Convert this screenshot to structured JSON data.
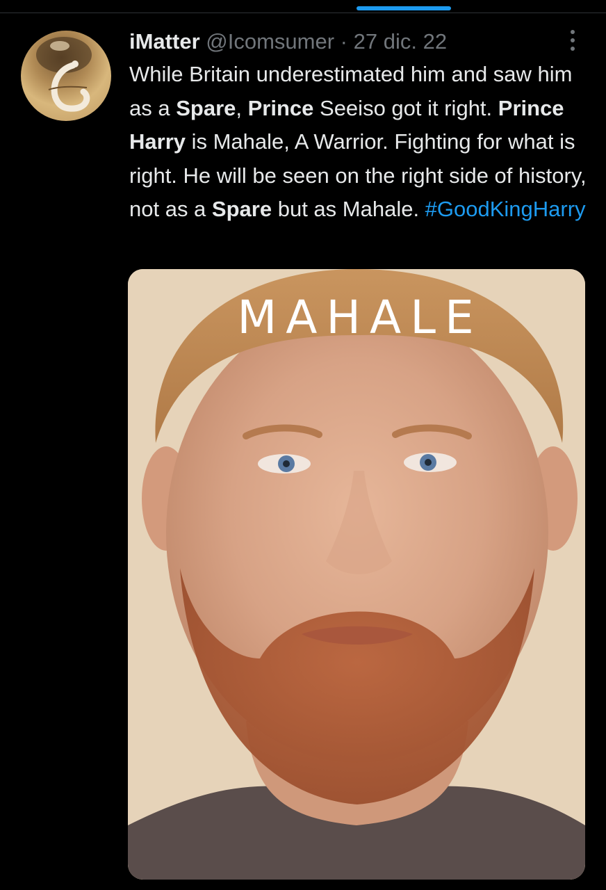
{
  "tweet": {
    "author_name": "iMatter",
    "handle": "@Icomsumer",
    "separator": "·",
    "date": "27 dic. 22",
    "text_parts": [
      {
        "t": "While Britain underestimated him and saw him as a ",
        "style": "plain"
      },
      {
        "t": "Spare",
        "style": "bold"
      },
      {
        "t": ", ",
        "style": "plain"
      },
      {
        "t": "Prince",
        "style": "bold"
      },
      {
        "t": " Seeiso got it right. ",
        "style": "plain"
      },
      {
        "t": "Prince Harry",
        "style": "bold"
      },
      {
        "t": " is Mahale, A Warrior. Fighting for what is right. He will be seen on the right side of history, not as a ",
        "style": "plain"
      },
      {
        "t": "Spare",
        "style": "bold"
      },
      {
        "t": " but as Mahale. ",
        "style": "plain"
      },
      {
        "t": "#GoodKingHarry",
        "style": "hashtag"
      }
    ],
    "media": {
      "cover_title": "MAHALE",
      "description_icon": "portrait-photo"
    }
  },
  "colors": {
    "background": "#000000",
    "text": "#e7e9ea",
    "secondary": "#71767b",
    "accent": "#1d9bf0"
  }
}
